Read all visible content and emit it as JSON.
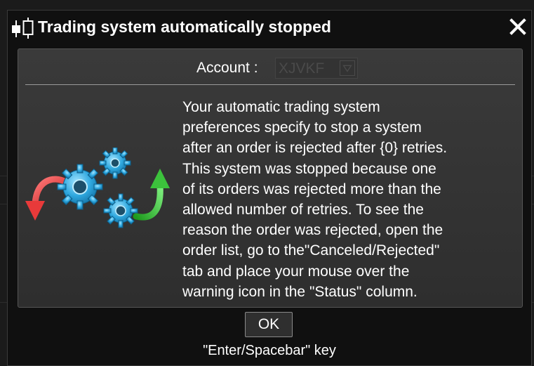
{
  "dialog": {
    "title": "Trading system automatically stopped",
    "close_label": "close",
    "account_label": "Account :",
    "account_value": "XJVKF",
    "message": "Your automatic trading system\npreferences specify to stop a system\nafter an order is rejected after {0} retries.\nThis system was stopped because one\nof its orders was rejected more than the\nallowed number of retries. To see the\nreason the order was rejected, open the\norder list, go to the\"Canceled/Rejected\"\ntab and place your mouse over the\nwarning icon in the \"Status\" column.",
    "ok_label": "OK",
    "hint": "\"Enter/Spacebar\" key"
  },
  "icons": {
    "title": "candlestick-chart-icon",
    "close": "close-icon",
    "dropdown": "dropdown-arrow-icon",
    "illustration": "gears-with-arrows-icon"
  },
  "colors": {
    "background": "#101010",
    "panel": "#353535",
    "text": "#ffffff",
    "gear": "#29a8e0",
    "arrow_down": "#e83a3a",
    "arrow_up": "#3cc23c"
  }
}
